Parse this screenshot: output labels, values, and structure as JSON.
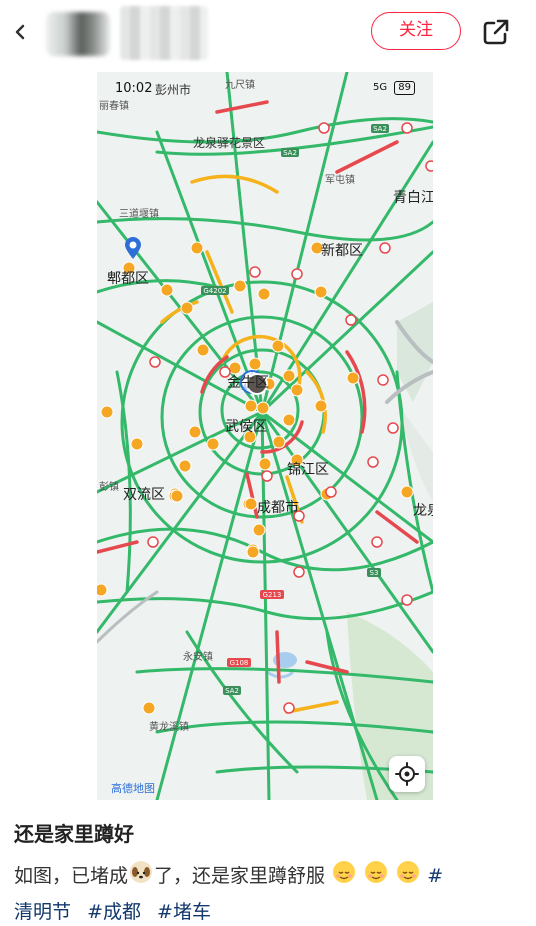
{
  "header": {
    "back_icon": "chevron-left-icon",
    "follow_label": "关注",
    "share_icon": "share-external-icon",
    "accent": "#ff2442"
  },
  "screenshot": {
    "status_time": "10:02",
    "status_signal": "5G",
    "battery": "89",
    "labels": {
      "pengzhou": "彭州市",
      "jiulong": "九尺镇",
      "shengjiao": "丽春镇",
      "longquan_area": "龙泉驿花景区",
      "junmin": "军屯镇",
      "qingbaijiang": "青白江",
      "sandao": "三道堰镇",
      "xindu": "新都区",
      "pidu": "郫都区",
      "jinniu": "金牛区",
      "wuhou": "武侯区",
      "jinjiang": "锦江区",
      "shuangliu": "双流区",
      "chengdu": "成都市",
      "longquan": "龙泉",
      "pengjiang": "彭镇",
      "yongan": "永安镇",
      "huanglong": "黄龙溪镇",
      "road_g4202": "G4202",
      "road_sa2": "SA2",
      "road_g213": "G213",
      "road_g108": "G108",
      "road_s3": "S3"
    },
    "logo": "高德地图",
    "road_colors": {
      "smooth": "#34b86a",
      "slow": "#f5b21b",
      "jam": "#e5484d"
    }
  },
  "post": {
    "title": "还是家里蹲好",
    "desc_part1": "如图，已堵成",
    "desc_part2": "了，还是家里蹲舒服",
    "desc_part3": "#",
    "tags": [
      "清明节",
      "#成都",
      "#堵车"
    ]
  }
}
